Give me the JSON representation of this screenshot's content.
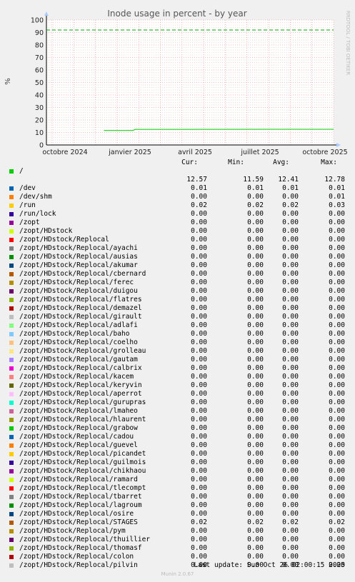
{
  "chart_data": {
    "type": "line",
    "title": "Inode usage in percent - by year",
    "ylabel": "%",
    "ylim": [
      0,
      100
    ],
    "yticks": [
      0,
      10,
      20,
      30,
      40,
      50,
      60,
      70,
      80,
      90,
      100
    ],
    "xticks": [
      "octobre 2024",
      "janvier 2025",
      "avril 2025",
      "juillet 2025",
      "octobre 2025"
    ],
    "grid": true,
    "watermark": "RRDTOOL / TOBI OETIKER",
    "series": [
      {
        "name": "/",
        "color": "#00cc00",
        "points": [
          [
            0.2,
            11.6
          ],
          [
            0.3,
            11.6
          ],
          [
            0.31,
            12.5
          ],
          [
            1.0,
            12.57
          ]
        ]
      },
      {
        "name": "warning",
        "color": "#00aa00",
        "dashed": true,
        "points": [
          [
            0,
            92
          ],
          [
            1,
            92
          ]
        ]
      }
    ]
  },
  "legend": {
    "headers": {
      "cur": "Cur:",
      "min": "Min:",
      "avg": "Avg:",
      "max": "Max:"
    },
    "rows": [
      {
        "name": "/",
        "color": "#00cc00",
        "cur": "12.57",
        "min": "11.59",
        "avg": "12.41",
        "max": "12.78",
        "wrap": true
      },
      {
        "name": "/dev",
        "color": "#0066b3",
        "cur": "0.01",
        "min": "0.01",
        "avg": "0.01",
        "max": "0.01"
      },
      {
        "name": "/dev/shm",
        "color": "#ff8000",
        "cur": "0.00",
        "min": "0.00",
        "avg": "0.00",
        "max": "0.01"
      },
      {
        "name": "/run",
        "color": "#ffcc00",
        "cur": "0.02",
        "min": "0.02",
        "avg": "0.02",
        "max": "0.03"
      },
      {
        "name": "/run/lock",
        "color": "#330099",
        "cur": "0.00",
        "min": "0.00",
        "avg": "0.00",
        "max": "0.00"
      },
      {
        "name": "/zopt",
        "color": "#990099",
        "cur": "0.00",
        "min": "0.00",
        "avg": "0.00",
        "max": "0.00"
      },
      {
        "name": "/zopt/HDstock",
        "color": "#ccff00",
        "cur": "0.00",
        "min": "0.00",
        "avg": "0.00",
        "max": "0.00"
      },
      {
        "name": "/zopt/HDstock/Replocal",
        "color": "#ff0000",
        "cur": "0.00",
        "min": "0.00",
        "avg": "0.00",
        "max": "0.00"
      },
      {
        "name": "/zopt/HDstock/Replocal/ayachi",
        "color": "#808080",
        "cur": "0.00",
        "min": "0.00",
        "avg": "0.00",
        "max": "0.00"
      },
      {
        "name": "/zopt/HDstock/Replocal/ausias",
        "color": "#008f00",
        "cur": "0.00",
        "min": "0.00",
        "avg": "0.00",
        "max": "0.00"
      },
      {
        "name": "/zopt/HDstock/Replocal/akumar",
        "color": "#00487d",
        "cur": "0.00",
        "min": "0.00",
        "avg": "0.00",
        "max": "0.00"
      },
      {
        "name": "/zopt/HDstock/Replocal/cbernard",
        "color": "#b35a00",
        "cur": "0.00",
        "min": "0.00",
        "avg": "0.00",
        "max": "0.00"
      },
      {
        "name": "/zopt/HDstock/Replocal/ferec",
        "color": "#b38f00",
        "cur": "0.00",
        "min": "0.00",
        "avg": "0.00",
        "max": "0.00"
      },
      {
        "name": "/zopt/HDstock/Replocal/duigou",
        "color": "#6b006b",
        "cur": "0.00",
        "min": "0.00",
        "avg": "0.00",
        "max": "0.00"
      },
      {
        "name": "/zopt/HDstock/Replocal/flatres",
        "color": "#8fb300",
        "cur": "0.00",
        "min": "0.00",
        "avg": "0.00",
        "max": "0.00"
      },
      {
        "name": "/zopt/HDstock/Replocal/demazel",
        "color": "#b30000",
        "cur": "0.00",
        "min": "0.00",
        "avg": "0.00",
        "max": "0.00"
      },
      {
        "name": "/zopt/HDstock/Replocal/girault",
        "color": "#bebebe",
        "cur": "0.00",
        "min": "0.00",
        "avg": "0.00",
        "max": "0.00"
      },
      {
        "name": "/zopt/HDstock/Replocal/adlafi",
        "color": "#80ff80",
        "cur": "0.00",
        "min": "0.00",
        "avg": "0.00",
        "max": "0.00"
      },
      {
        "name": "/zopt/HDstock/Replocal/baho",
        "color": "#80c9ff",
        "cur": "0.00",
        "min": "0.00",
        "avg": "0.00",
        "max": "0.00"
      },
      {
        "name": "/zopt/HDstock/Replocal/coelho",
        "color": "#ffc080",
        "cur": "0.00",
        "min": "0.00",
        "avg": "0.00",
        "max": "0.00"
      },
      {
        "name": "/zopt/HDstock/Replocal/grolleau",
        "color": "#ffe680",
        "cur": "0.00",
        "min": "0.00",
        "avg": "0.00",
        "max": "0.00"
      },
      {
        "name": "/zopt/HDstock/Replocal/gautam",
        "color": "#aa80ff",
        "cur": "0.00",
        "min": "0.00",
        "avg": "0.00",
        "max": "0.00"
      },
      {
        "name": "/zopt/HDstock/Replocal/calbrix",
        "color": "#ee00cc",
        "cur": "0.00",
        "min": "0.00",
        "avg": "0.00",
        "max": "0.00"
      },
      {
        "name": "/zopt/HDstock/Replocal/kacem",
        "color": "#ff8080",
        "cur": "0.00",
        "min": "0.00",
        "avg": "0.00",
        "max": "0.00"
      },
      {
        "name": "/zopt/HDstock/Replocal/keryvin",
        "color": "#666600",
        "cur": "0.00",
        "min": "0.00",
        "avg": "0.00",
        "max": "0.00"
      },
      {
        "name": "/zopt/HDstock/Replocal/aperrot",
        "color": "#ffbfff",
        "cur": "0.00",
        "min": "0.00",
        "avg": "0.00",
        "max": "0.00"
      },
      {
        "name": "/zopt/HDstock/Replocal/gurupras",
        "color": "#00ffcc",
        "cur": "0.00",
        "min": "0.00",
        "avg": "0.00",
        "max": "0.00"
      },
      {
        "name": "/zopt/HDstock/Replocal/lmaheo",
        "color": "#cc6699",
        "cur": "0.00",
        "min": "0.00",
        "avg": "0.00",
        "max": "0.00"
      },
      {
        "name": "/zopt/HDstock/Replocal/hlaurent",
        "color": "#999900",
        "cur": "0.00",
        "min": "0.00",
        "avg": "0.00",
        "max": "0.00"
      },
      {
        "name": "/zopt/HDstock/Replocal/grabow",
        "color": "#00cc00",
        "cur": "0.00",
        "min": "0.00",
        "avg": "0.00",
        "max": "0.00"
      },
      {
        "name": "/zopt/HDstock/Replocal/cadou",
        "color": "#0066b3",
        "cur": "0.00",
        "min": "0.00",
        "avg": "0.00",
        "max": "0.00"
      },
      {
        "name": "/zopt/HDstock/Replocal/guevel",
        "color": "#ff8000",
        "cur": "0.00",
        "min": "0.00",
        "avg": "0.00",
        "max": "0.00"
      },
      {
        "name": "/zopt/HDstock/Replocal/picandet",
        "color": "#ffcc00",
        "cur": "0.00",
        "min": "0.00",
        "avg": "0.00",
        "max": "0.00"
      },
      {
        "name": "/zopt/HDstock/Replocal/guilmois",
        "color": "#330099",
        "cur": "0.00",
        "min": "0.00",
        "avg": "0.00",
        "max": "0.00"
      },
      {
        "name": "/zopt/HDstock/Replocal/chikhaou",
        "color": "#990099",
        "cur": "0.00",
        "min": "0.00",
        "avg": "0.00",
        "max": "0.00"
      },
      {
        "name": "/zopt/HDstock/Replocal/ramard",
        "color": "#ccff00",
        "cur": "0.00",
        "min": "0.00",
        "avg": "0.00",
        "max": "0.00"
      },
      {
        "name": "/zopt/HDstock/Replocal/tlecompt",
        "color": "#ff0000",
        "cur": "0.00",
        "min": "0.00",
        "avg": "0.00",
        "max": "0.00"
      },
      {
        "name": "/zopt/HDstock/Replocal/tbarret",
        "color": "#808080",
        "cur": "0.00",
        "min": "0.00",
        "avg": "0.00",
        "max": "0.00"
      },
      {
        "name": "/zopt/HDstock/Replocal/lagroum",
        "color": "#008f00",
        "cur": "0.00",
        "min": "0.00",
        "avg": "0.00",
        "max": "0.00"
      },
      {
        "name": "/zopt/HDstock/Replocal/osire",
        "color": "#00487d",
        "cur": "0.00",
        "min": "0.00",
        "avg": "0.00",
        "max": "0.00"
      },
      {
        "name": "/zopt/HDstock/Replocal/STAGES",
        "color": "#b35a00",
        "cur": "0.02",
        "min": "0.02",
        "avg": "0.02",
        "max": "0.02"
      },
      {
        "name": "/zopt/HDstock/Replocal/pym",
        "color": "#b38f00",
        "cur": "0.00",
        "min": "0.00",
        "avg": "0.00",
        "max": "0.00"
      },
      {
        "name": "/zopt/HDstock/Replocal/thuillier",
        "color": "#6b006b",
        "cur": "0.00",
        "min": "0.00",
        "avg": "0.00",
        "max": "0.00"
      },
      {
        "name": "/zopt/HDstock/Replocal/thomasf",
        "color": "#8fb300",
        "cur": "0.00",
        "min": "0.00",
        "avg": "0.00",
        "max": "0.00"
      },
      {
        "name": "/zopt/HDstock/Replocal/colon",
        "color": "#b30000",
        "cur": "0.00",
        "min": "0.00",
        "avg": "0.00",
        "max": "0.00"
      },
      {
        "name": "/zopt/HDstock/Replocal/pilvin",
        "color": "#bebebe",
        "cur": "0.00",
        "min": "0.00",
        "avg": "0.00",
        "max": "0.00"
      }
    ]
  },
  "footer": {
    "last_update": "Last update: Sun Oct 26 02:00:15 2025",
    "generator": "Munin 2.0.67"
  }
}
